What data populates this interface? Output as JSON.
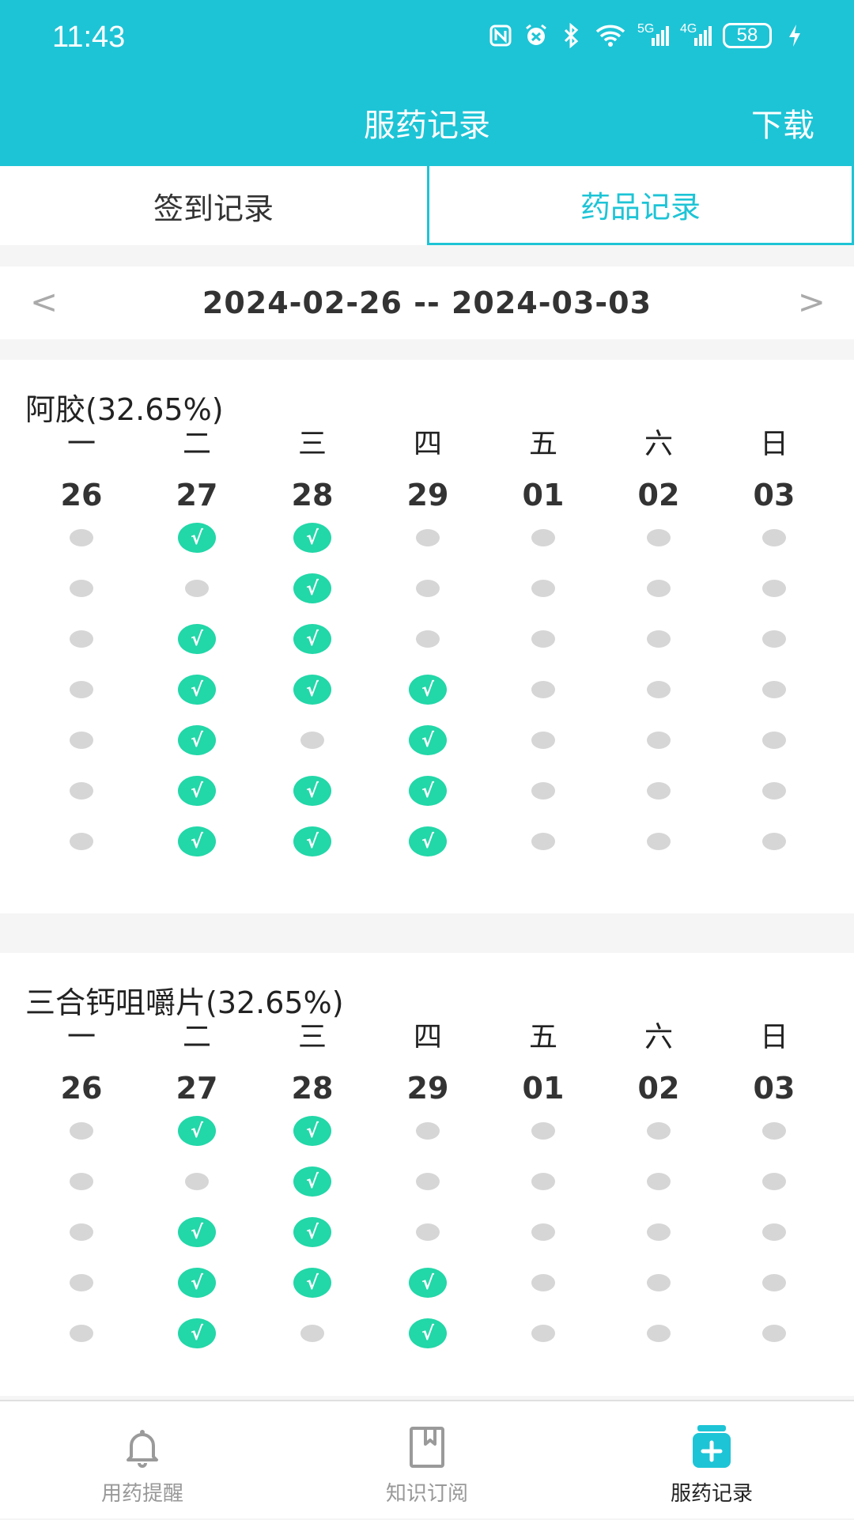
{
  "status_bar": {
    "time": "11:43",
    "icons": [
      "nfc-icon",
      "alarm-icon",
      "bluetooth-icon",
      "wifi-icon",
      "signal-5g-icon",
      "signal-4g-icon",
      "battery-icon",
      "charging-icon"
    ],
    "signal_5g": "5G",
    "signal_4g": "4G",
    "battery": "58"
  },
  "header": {
    "title": "服药记录",
    "download_label": "下载"
  },
  "tabs": [
    {
      "label": "签到记录",
      "active": false
    },
    {
      "label": "药品记录",
      "active": true
    }
  ],
  "week": {
    "range": "2024-02-26 -- 2024-03-03",
    "prev": "<",
    "next": ">"
  },
  "weekdays": [
    "一",
    "二",
    "三",
    "四",
    "五",
    "六",
    "日"
  ],
  "dates": [
    "26",
    "27",
    "28",
    "29",
    "01",
    "02",
    "03"
  ],
  "check_symbol": "√",
  "medications": [
    {
      "name": "阿胶(32.65%)",
      "rows": [
        [
          0,
          1,
          1,
          0,
          0,
          0,
          0
        ],
        [
          0,
          0,
          1,
          0,
          0,
          0,
          0
        ],
        [
          0,
          1,
          1,
          0,
          0,
          0,
          0
        ],
        [
          0,
          1,
          1,
          1,
          0,
          0,
          0
        ],
        [
          0,
          1,
          0,
          1,
          0,
          0,
          0
        ],
        [
          0,
          1,
          1,
          1,
          0,
          0,
          0
        ],
        [
          0,
          1,
          1,
          1,
          0,
          0,
          0
        ]
      ]
    },
    {
      "name": "三合钙咀嚼片(32.65%)",
      "rows": [
        [
          0,
          1,
          1,
          0,
          0,
          0,
          0
        ],
        [
          0,
          0,
          1,
          0,
          0,
          0,
          0
        ],
        [
          0,
          1,
          1,
          0,
          0,
          0,
          0
        ],
        [
          0,
          1,
          1,
          1,
          0,
          0,
          0
        ],
        [
          0,
          1,
          0,
          1,
          0,
          0,
          0
        ]
      ]
    }
  ],
  "bottom_nav": [
    {
      "label": "用药提醒",
      "icon": "bell-icon",
      "active": false
    },
    {
      "label": "知识订阅",
      "icon": "book-icon",
      "active": false
    },
    {
      "label": "服药记录",
      "icon": "medicine-bottle-icon",
      "active": true
    }
  ],
  "colors": {
    "primary": "#1dc4d6",
    "check": "#22d7a8",
    "dot": "#d6d6d6"
  }
}
